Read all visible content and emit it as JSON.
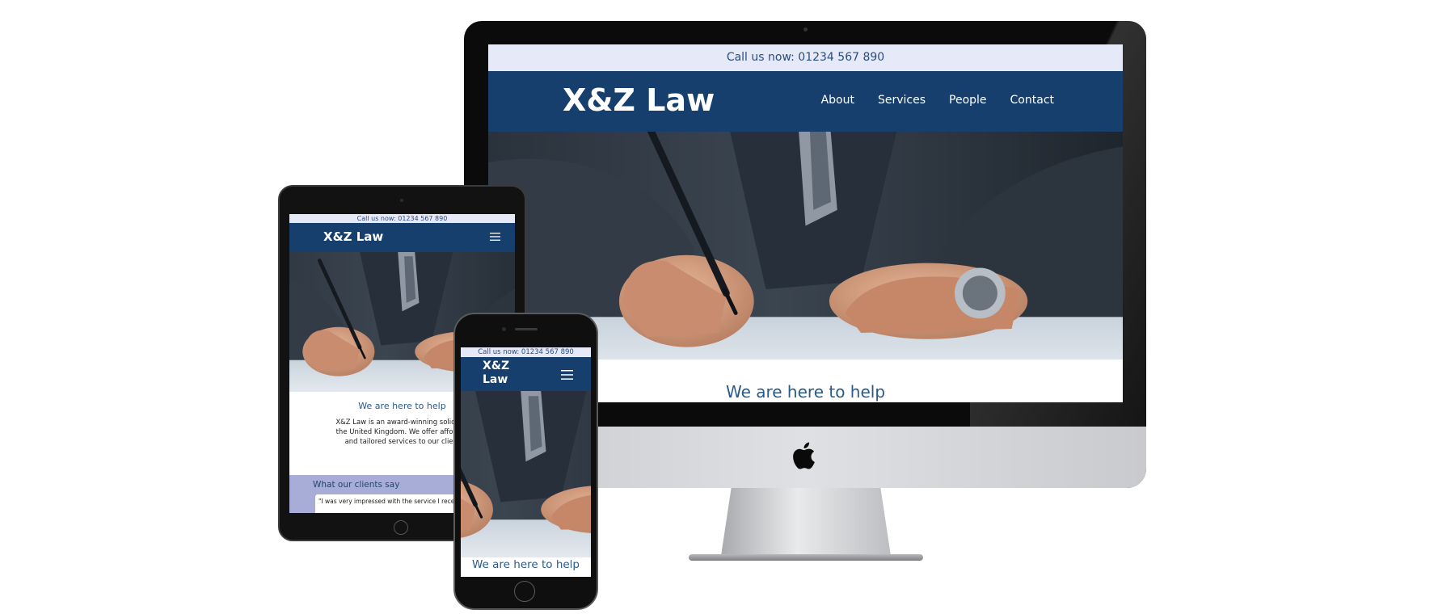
{
  "site": {
    "phone_banner": "Call us now: 01234 567 890",
    "logo": "X&Z Law",
    "nav": [
      "About",
      "Services",
      "People",
      "Contact"
    ],
    "help_heading": "We are here to help",
    "intro_text": "X&Z Law is an award-winning solicitor in the United Kingdom. We offer affordable and tailored services to our clients.",
    "testimonials_heading": "What our clients say",
    "testimonial_preview": "\"I was very impressed with the service I received from X&Z Law. They were very professional and helpful. I would"
  },
  "devices": [
    "desktop-imac",
    "tablet-ipad",
    "phone-iphone"
  ],
  "colors": {
    "navbar": "#163f6e",
    "topbar": "#e6e9f7",
    "topbar_text": "#2b4c7e",
    "heading_text": "#2b5a8a",
    "testimonial_band": "#a7add6"
  },
  "icons": [
    "apple-logo-icon",
    "hamburger-menu-icon"
  ]
}
